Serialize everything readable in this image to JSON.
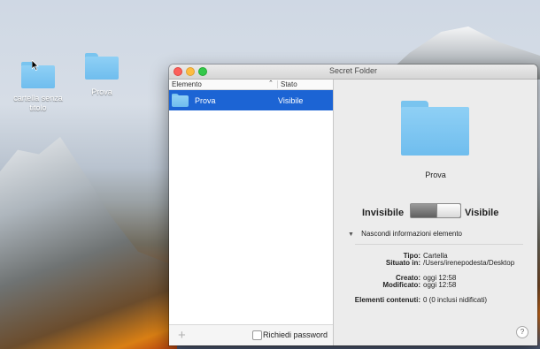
{
  "desktop": {
    "icons": [
      {
        "label": "cartella senza titolo"
      },
      {
        "label": "Prova"
      }
    ]
  },
  "window": {
    "title": "Secret Folder",
    "table": {
      "col_item": "Elemento",
      "col_status": "Stato",
      "rows": [
        {
          "name": "Prova",
          "status": "Visibile"
        }
      ]
    },
    "add_symbol": "+",
    "password_label": "Richiedi password",
    "detail": {
      "name": "Prova",
      "invisible_label": "Invisibile",
      "visible_label": "Visibile",
      "disclosure_label": "Nascondi informazioni elemento",
      "type_key": "Tipo:",
      "type_val": "Cartella",
      "location_key": "Situato in:",
      "location_val": "/Users/irenepodesta/Desktop",
      "created_key": "Creato:",
      "created_val": "oggi 12:58",
      "modified_key": "Modificato:",
      "modified_val": "oggi 12:58",
      "contents_key": "Elementi contenuti:",
      "contents_val": "0 (0 inclusi nidificati)"
    },
    "help_symbol": "?"
  },
  "colors": {
    "selection": "#1c64d4",
    "folder": "#6fbdee"
  }
}
